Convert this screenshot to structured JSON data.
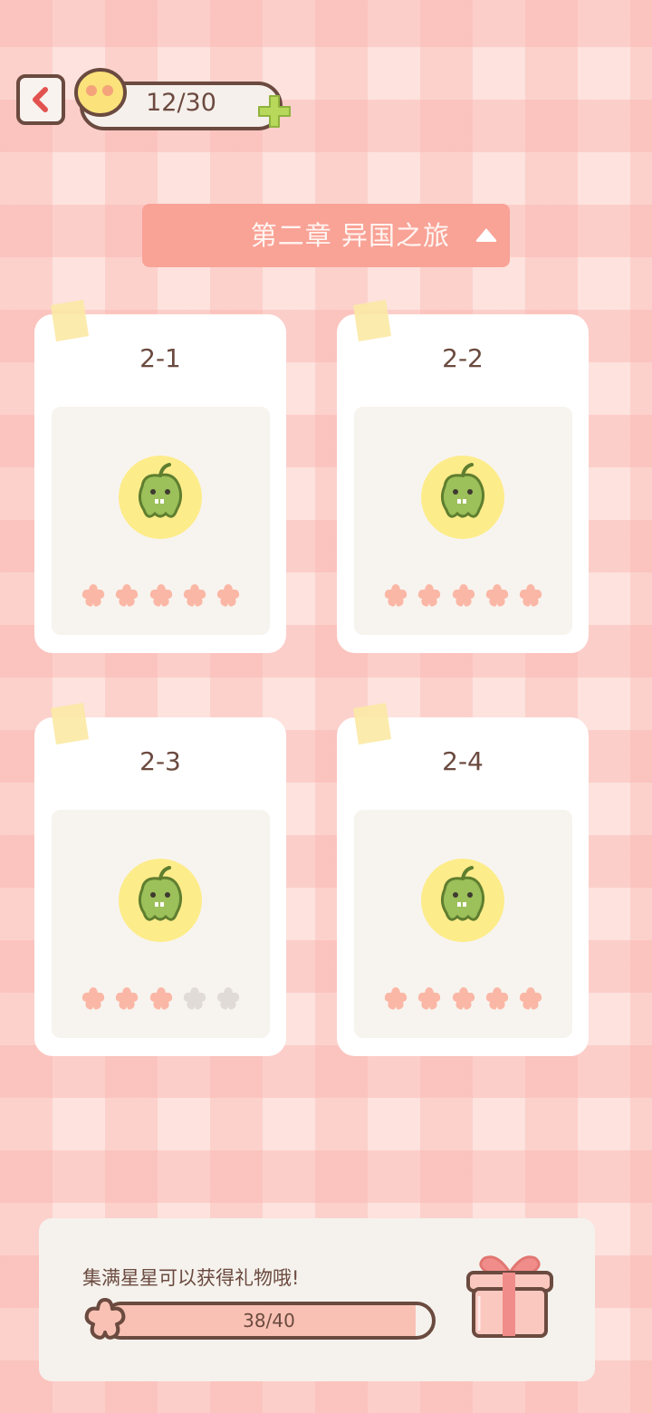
{
  "topbar": {
    "energy": "12/30"
  },
  "chapter": {
    "title": "第二章  异国之旅"
  },
  "levels": [
    {
      "label": "2-1",
      "stars_earned": 5,
      "stars_total": 5
    },
    {
      "label": "2-2",
      "stars_earned": 5,
      "stars_total": 5
    },
    {
      "label": "2-3",
      "stars_earned": 3,
      "stars_total": 5
    },
    {
      "label": "2-4",
      "stars_earned": 5,
      "stars_total": 5
    }
  ],
  "reward": {
    "hint": "集满星星可以获得礼物哦!",
    "progress_text": "38/40",
    "progress_current": 38,
    "progress_total": 40
  },
  "colors": {
    "star_filled": "#fbb7a6",
    "star_empty": "#e0dbd6",
    "accent": "#f9a296",
    "outline": "#6b4a3f"
  },
  "icons": [
    "back-icon",
    "energy-face-icon",
    "plus-icon",
    "triangle-up-icon",
    "tape-icon",
    "pepper-icon",
    "star-icon",
    "gift-icon"
  ]
}
